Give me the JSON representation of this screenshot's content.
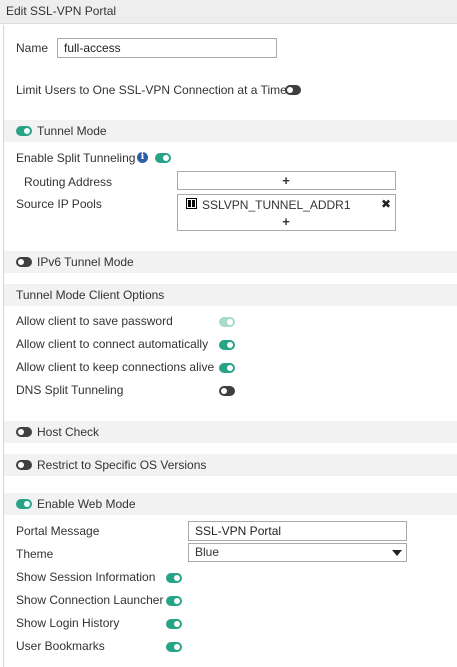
{
  "window": {
    "title": "Edit SSL-VPN Portal"
  },
  "name": {
    "label": "Name",
    "value": "full-access"
  },
  "limit_users": {
    "label": "Limit Users to One SSL-VPN Connection at a Time"
  },
  "tunnel_mode": {
    "label": "Tunnel Mode",
    "split_tunneling_label": "Enable Split Tunneling",
    "routing_address_label": "Routing Address",
    "routing_address_add": "+",
    "source_ip_pools_label": "Source IP Pools",
    "source_ip_pool_entry": "SSLVPN_TUNNEL_ADDR1",
    "source_ip_pool_remove": "✖",
    "source_ip_pool_add": "+"
  },
  "ipv6_tunnel_mode": {
    "label": "IPv6 Tunnel Mode"
  },
  "client_options": {
    "header": "Tunnel Mode Client Options",
    "items": [
      {
        "label": "Allow client to save password"
      },
      {
        "label": "Allow client to connect automatically"
      },
      {
        "label": "Allow client to keep connections alive"
      },
      {
        "label": "DNS Split Tunneling"
      }
    ]
  },
  "host_check": {
    "label": "Host Check"
  },
  "restrict_os": {
    "label": "Restrict to Specific OS Versions"
  },
  "web_mode": {
    "label": "Enable Web Mode",
    "portal_message_label": "Portal Message",
    "portal_message_value": "SSL-VPN Portal",
    "theme_label": "Theme",
    "theme_value": "Blue",
    "items": [
      {
        "label": "Show Session Information"
      },
      {
        "label": "Show Connection Launcher"
      },
      {
        "label": "Show Login History"
      },
      {
        "label": "User Bookmarks"
      }
    ]
  },
  "colors": {
    "toggle_on": "#27a387",
    "toggle_off": "#3f3f3f",
    "band": "#f2f2f2"
  }
}
